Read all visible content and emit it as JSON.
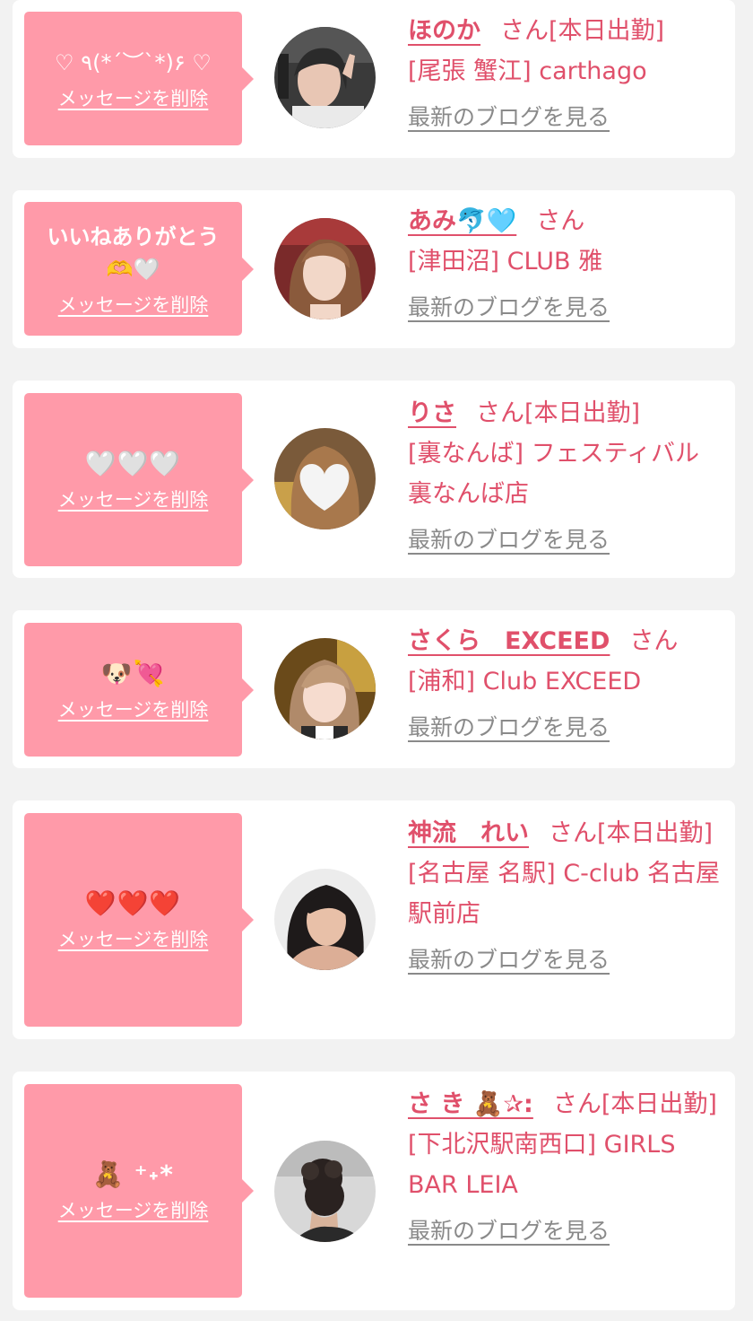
{
  "common": {
    "delete_label": "メッセージを削除",
    "blog_label": "最新のブログを見る",
    "honorific": "さん"
  },
  "colors": {
    "accent": "#e0506b",
    "bubble": "#ff9aa9",
    "link_gray": "#8a8a8a",
    "background": "#f2f2f2"
  },
  "entries": [
    {
      "message": "♡ ٩(*´︶`*)۶ ♡",
      "cast_name": "ほのか",
      "status": "[本日出勤]",
      "shop": "[尾張 蟹江] carthago"
    },
    {
      "message": "いいねありがとう\n🫶🤍",
      "cast_name": "あみ🐬🩵",
      "status": "",
      "shop": "[津田沼] CLUB 雅"
    },
    {
      "message": "🤍🤍🤍",
      "cast_name": "りさ",
      "status": "[本日出勤]",
      "shop": "[裏なんば] フェスティバル裏なんば店"
    },
    {
      "message": "🐶💘",
      "cast_name": "さくら　EXCEED",
      "status": "",
      "shop": "[浦和] Club EXCEED"
    },
    {
      "message": "❤️❤️❤️",
      "cast_name": "神流　れい",
      "status": "[本日出勤]",
      "shop": "[名古屋 名駅] C-club 名古屋駅前店"
    },
    {
      "message": "🧸 ⁺˖*",
      "cast_name": "さ き 🧸✰:",
      "status": "[本日出勤]",
      "shop": "[下北沢駅南西口] GIRLS BAR LEIA"
    }
  ]
}
